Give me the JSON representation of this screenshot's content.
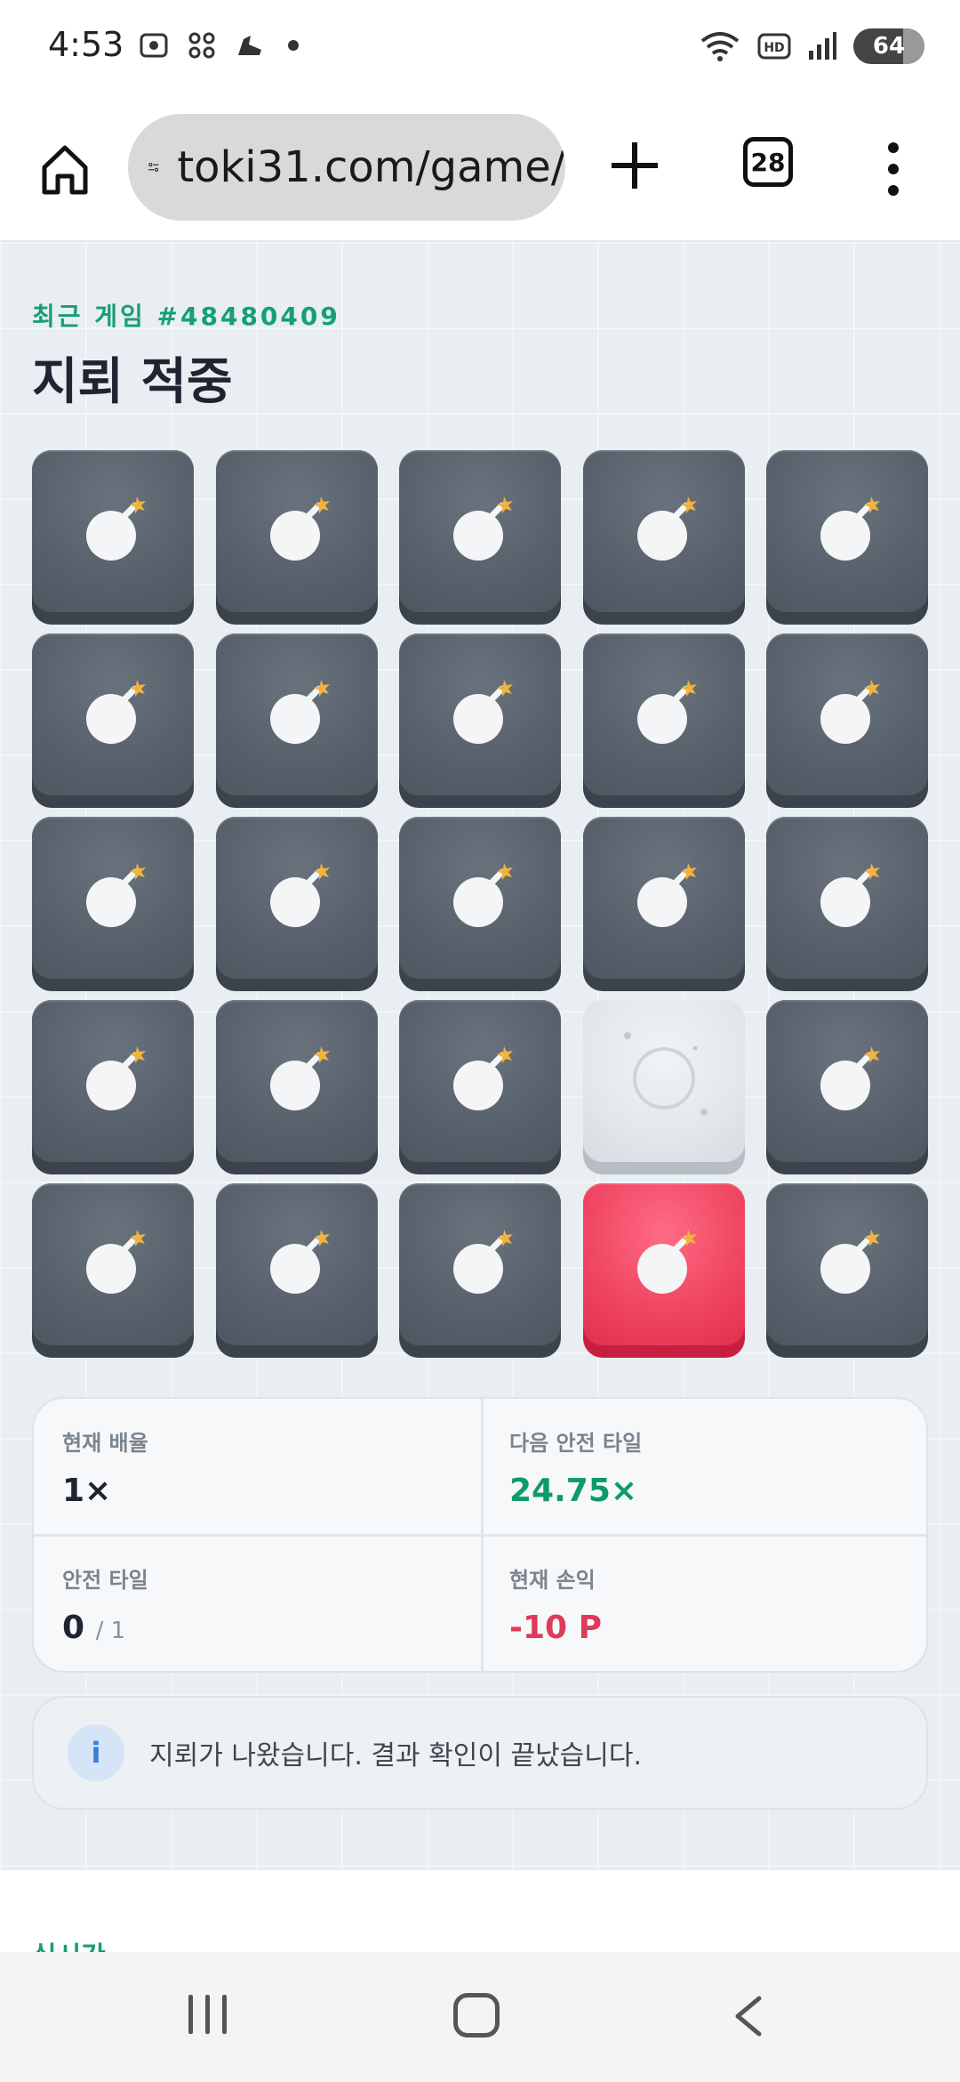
{
  "status_bar": {
    "time": "4:53",
    "battery": "64"
  },
  "browser": {
    "url": "toki31.com/game/",
    "tab_count": "28"
  },
  "game": {
    "label": "최근 게임 #48480409",
    "title": "지뢰 적중",
    "tiles": [
      "mine",
      "mine",
      "mine",
      "mine",
      "mine",
      "mine",
      "mine",
      "mine",
      "mine",
      "mine",
      "mine",
      "mine",
      "mine",
      "mine",
      "mine",
      "mine",
      "mine",
      "mine",
      "safe",
      "mine",
      "mine",
      "mine",
      "mine",
      "hit",
      "mine"
    ]
  },
  "stats": {
    "current_multiplier_label": "현재 배율",
    "current_multiplier_value": "1×",
    "next_safe_label": "다음 안전 타일",
    "next_safe_value": "24.75×",
    "safe_tiles_label": "안전 타일",
    "safe_tiles_value": "0",
    "safe_tiles_total": "/ 1",
    "profit_label": "현재 손익",
    "profit_value": "-10 P"
  },
  "notice": {
    "icon": "i",
    "text": "지뢰가 나왔습니다. 결과 확인이 끝났습니다."
  },
  "below": {
    "section_label": "실시간"
  },
  "colors": {
    "accent_green": "#15a070",
    "mine_tile": "#59626c",
    "hit_tile": "#f04763",
    "loss_red": "#de3a5a"
  }
}
